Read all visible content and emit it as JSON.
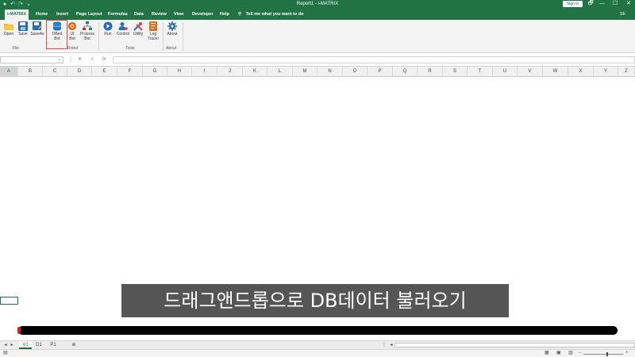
{
  "window": {
    "title": "Report1 - i-MATRIX",
    "sign_in": "Sign in",
    "quick_access": [
      "↶",
      "↷",
      "⌄"
    ],
    "controls": [
      "🗗",
      "—",
      "☐",
      "✕"
    ]
  },
  "tabs": [
    "i-MATRIX",
    "Home",
    "Insert",
    "Page Layout",
    "Formulas",
    "Data",
    "Review",
    "View",
    "Developer",
    "Help"
  ],
  "tell_me": "Tell me what you want to do",
  "account_initial": "Sh",
  "ribbon": {
    "file_group": {
      "label": "File",
      "buttons": [
        "Open",
        "Save",
        "SaveAs"
      ]
    },
    "robot_group": {
      "label": "Robot",
      "buttons": [
        [
          "DBed",
          "Bot"
        ],
        [
          "UI",
          "Bot"
        ],
        [
          "Process",
          "Bot"
        ]
      ]
    },
    "tools_group": {
      "label": "Tools",
      "buttons": [
        [
          "Run"
        ],
        [
          "Control"
        ],
        [
          "Utility"
        ],
        [
          "Log",
          "Tracer"
        ]
      ]
    },
    "about_group": {
      "label": "About",
      "buttons": [
        "About"
      ]
    }
  },
  "formula_bar": {
    "cancel": "✕",
    "enter": "✓",
    "fx": "fx"
  },
  "columns": [
    "A",
    "B",
    "C",
    "D",
    "E",
    "F",
    "G",
    "H",
    "I",
    "J",
    "K",
    "L",
    "M",
    "N",
    "O",
    "P",
    "Q",
    "R",
    "S",
    "T",
    "U",
    "V",
    "W",
    "X",
    "Y",
    "Z"
  ],
  "subtitle": "드래그앤드롭으로 DB데이터 불러오기",
  "sheets": [
    "V1",
    "D1",
    "P1"
  ],
  "add_sheet": "⊕",
  "colors": {
    "accent": "#217346",
    "highlight": "#e64646"
  }
}
